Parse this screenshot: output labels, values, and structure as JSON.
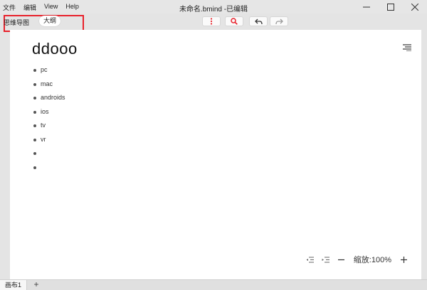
{
  "menu": {
    "file": "文件",
    "edit": "编辑",
    "view": "View",
    "help": "Help"
  },
  "window": {
    "title": "未命名.bmind -已编辑"
  },
  "toolbar": {
    "view_label": "思维导图",
    "view_active": "大纲",
    "highlight_color": "#e8212b",
    "icons": [
      "more-vertical-icon",
      "search-icon",
      "undo-icon",
      "redo-icon"
    ]
  },
  "document": {
    "title": "ddooo",
    "items": [
      "pc",
      "mac",
      "androids",
      "ios",
      "tv",
      "vr",
      "",
      ""
    ]
  },
  "zoom": {
    "label": "缩放:100%"
  },
  "tabs": {
    "sheet": "画布1",
    "add": "+"
  }
}
